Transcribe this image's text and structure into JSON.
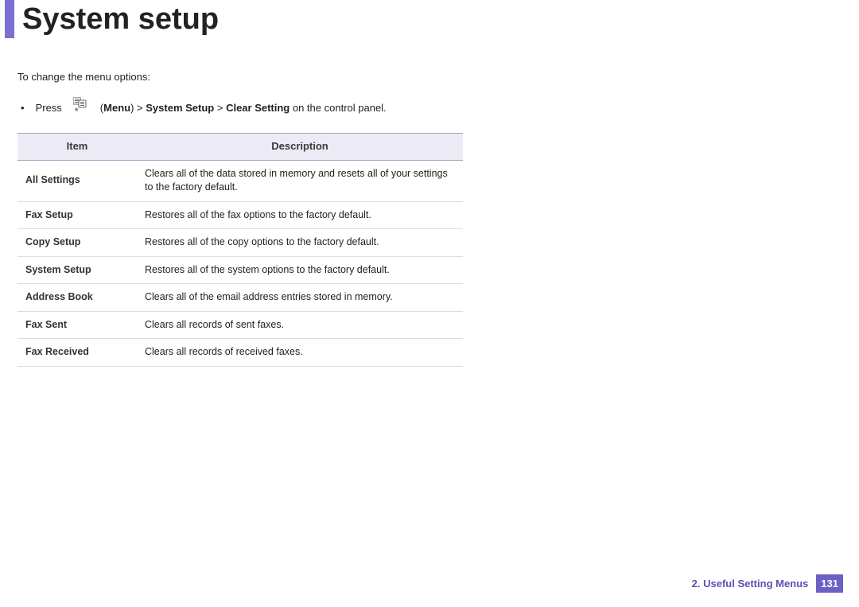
{
  "title": "System setup",
  "intro": "To change the menu options:",
  "press_label": "Press",
  "menu_path": {
    "open_paren": "(",
    "menu": "Menu",
    "close_paren": ") > ",
    "system_setup": "System Setup",
    "sep2": " > ",
    "clear_setting": "Clear Setting",
    "suffix": " on the control panel."
  },
  "table_headers": {
    "item": "Item",
    "description": "Description"
  },
  "rows": [
    {
      "item": "All Settings",
      "desc": "Clears all of the data stored in memory and resets all of your settings to the factory default."
    },
    {
      "item": "Fax Setup",
      "desc": "Restores all of the fax options to the factory default."
    },
    {
      "item": "Copy Setup",
      "desc": "Restores all of the copy options to the factory default."
    },
    {
      "item": "System Setup",
      "desc": "Restores all of the system options to the factory default."
    },
    {
      "item": "Address Book",
      "desc": "Clears all of the email address entries stored in memory."
    },
    {
      "item": "Fax Sent",
      "desc": "Clears all records of sent faxes."
    },
    {
      "item": "Fax Received",
      "desc": "Clears all records of received faxes."
    }
  ],
  "footer": {
    "section": "2.  Useful Setting Menus",
    "page": "131"
  }
}
